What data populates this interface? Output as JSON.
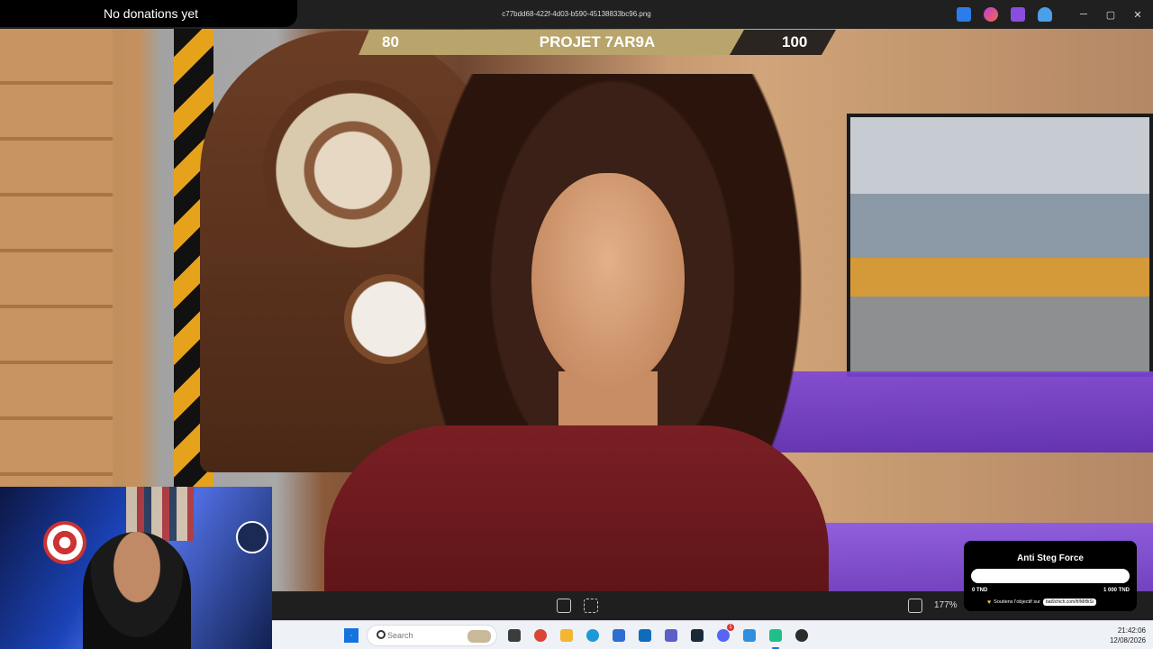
{
  "window": {
    "filename": "c77bdd68-422f-4d03-b590-45138833bc96.png",
    "minimize": "─",
    "maximize": "▢",
    "close": "✕",
    "title_icons": [
      "image-edit-icon",
      "copilot-icon",
      "clipchamp-icon",
      "cloud-icon"
    ]
  },
  "overlay": {
    "donation_text": "No donations yet",
    "score_left": "80",
    "score_title": "PROJET 7AR9A",
    "score_right": "100"
  },
  "viewer": {
    "zoom": "177%"
  },
  "goal": {
    "title": "Anti Steg Force",
    "progress": 0,
    "min_label": "0 TND",
    "max_label": "1 000 TND",
    "footer": "Soutiens l'objectif sur",
    "url": "bat9chich.com/fr/MrBiSi"
  },
  "taskbar": {
    "search_placeholder": "Search",
    "time": "21:42:06",
    "date": "12/08/2026",
    "apps": [
      {
        "name": "task-view-icon",
        "color": "#3c3c3c"
      },
      {
        "name": "chrome-icon",
        "color": "#db4437"
      },
      {
        "name": "file-explorer-icon",
        "color": "#f2b632"
      },
      {
        "name": "edge-icon",
        "color": "#1a9bd7"
      },
      {
        "name": "store-icon",
        "color": "#2c6fd1"
      },
      {
        "name": "outlook-icon",
        "color": "#0f6cbd"
      },
      {
        "name": "teams-icon",
        "color": "#5b5fc7"
      },
      {
        "name": "steam-icon",
        "color": "#1b2838"
      },
      {
        "name": "discord-icon",
        "color": "#5865f2"
      },
      {
        "name": "photos-icon",
        "color": "#2e8fe0"
      },
      {
        "name": "app-active-icon",
        "color": "#1fbf8a"
      },
      {
        "name": "media-player-icon",
        "color": "#2d2d2d"
      }
    ],
    "discord_badge": "1"
  }
}
